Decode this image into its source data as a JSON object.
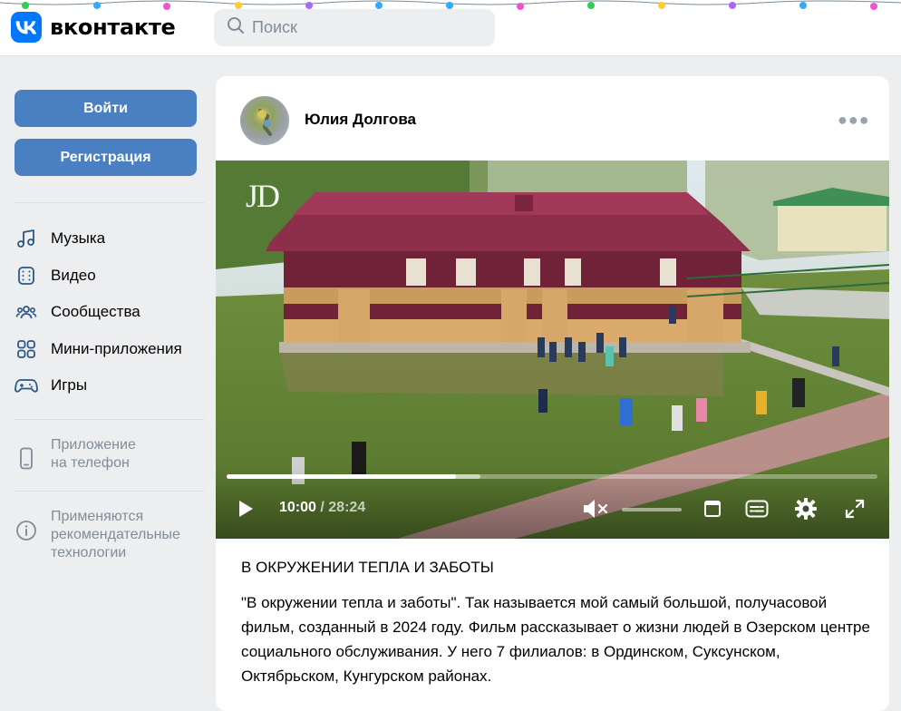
{
  "header": {
    "logo_text": "вконтакте",
    "search_placeholder": "Поиск"
  },
  "sidebar": {
    "login_label": "Войти",
    "register_label": "Регистрация",
    "nav": [
      {
        "label": "Музыка",
        "icon": "music-icon"
      },
      {
        "label": "Видео",
        "icon": "video-icon"
      },
      {
        "label": "Сообщества",
        "icon": "communities-icon"
      },
      {
        "label": "Мини-приложения",
        "icon": "mini-apps-icon"
      },
      {
        "label": "Игры",
        "icon": "gamepad-icon"
      }
    ],
    "phone_app_line1": "Приложение",
    "phone_app_line2": "на телефон",
    "rec_line1": "Применяются",
    "rec_line2": "рекомендательные",
    "rec_line3": "технологии"
  },
  "post": {
    "author": "Юлия Долгова",
    "watermark": "JD",
    "video": {
      "current_time": "10:00",
      "separator": " / ",
      "duration": "28:24",
      "progress_fraction": 0.352,
      "buffered_fraction": 0.39
    },
    "title": "В ОКРУЖЕНИИ ТЕПЛА И ЗАБОТЫ",
    "text": "\"В окружении тепла и заботы\". Так называется мой самый большой, получасовой фильм, созданный в 2024 году. Фильм рассказывает о жизни людей в Озерском центре социального обслуживания. У него 7 филиалов: в Ординском, Суксунском, Октябрьском, Кунгурском районах."
  },
  "colors": {
    "brand": "#0077ff",
    "button": "#4a80c2",
    "nav_icon": "#2a5885",
    "muted": "#818c99",
    "page_bg": "#edeef0"
  }
}
